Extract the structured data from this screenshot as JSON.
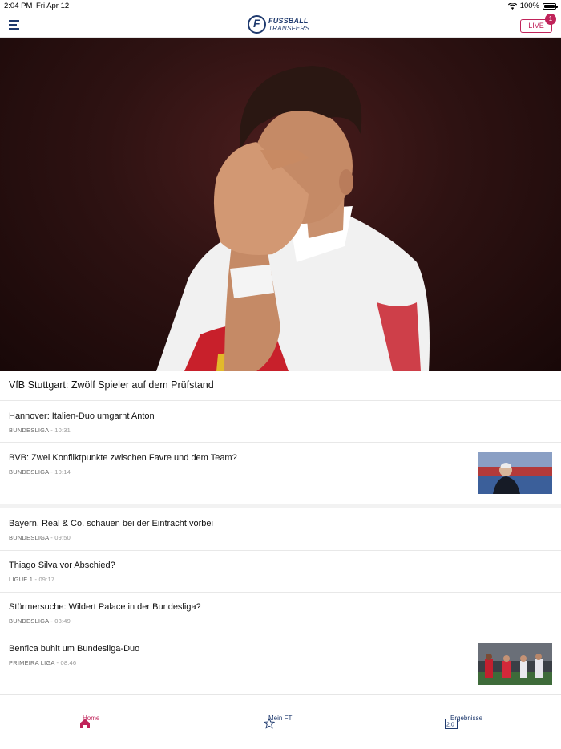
{
  "status": {
    "time": "2:04 PM",
    "date": "Fri Apr 12",
    "battery": "100%"
  },
  "header": {
    "logo_line1": "FUSSBALL",
    "logo_line2": "TRANSFERS",
    "live_label": "LIVE",
    "live_count": "1"
  },
  "hero": {
    "title": "VfB Stuttgart: Zwölf Spieler auf dem Prüfstand"
  },
  "articles": [
    {
      "title": "Hannover: Italien-Duo umgarnt Anton",
      "league": "BUNDESLIGA",
      "time": "10:31"
    },
    {
      "title": "BVB: Zwei Konfliktpunkte zwischen Favre und dem Team?",
      "league": "BUNDESLIGA",
      "time": "10:14"
    },
    {
      "title": "Bayern, Real & Co. schauen bei der Eintracht vorbei",
      "league": "BUNDESLIGA",
      "time": "09:50"
    },
    {
      "title": "Thiago Silva vor Abschied?",
      "league": "LIGUE 1",
      "time": "09:17"
    },
    {
      "title": "Stürmersuche: Wildert Palace in der Bundesliga?",
      "league": "BUNDESLIGA",
      "time": "08:49"
    },
    {
      "title": "Benfica buhlt um Bundesliga-Duo",
      "league": "PRIMEIRA LIGA",
      "time": "08:46"
    }
  ],
  "tabs": [
    {
      "label": "Home",
      "icon": "home-icon"
    },
    {
      "label": "Mein FT",
      "icon": "star-icon"
    },
    {
      "label": "Ergebnisse",
      "icon": "scoreboard-icon"
    }
  ],
  "colors": {
    "brand_navy": "#1f3a6e",
    "accent": "#c0235a"
  }
}
